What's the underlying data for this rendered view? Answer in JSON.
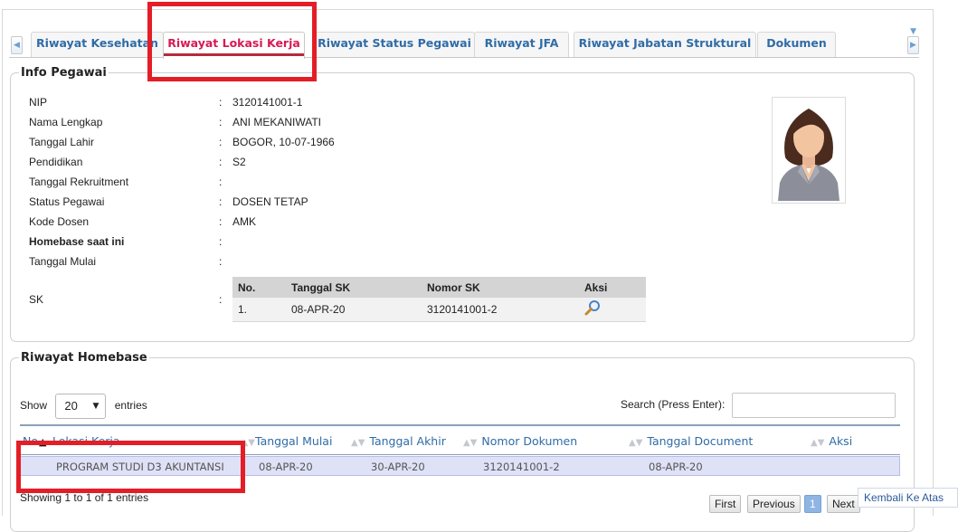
{
  "tabs": [
    {
      "label": "Riwayat Kesehatan",
      "active": false
    },
    {
      "label": "Riwayat Lokasi Kerja",
      "active": true
    },
    {
      "label": "Riwayat Status Pegawai",
      "active": false
    },
    {
      "label": "Riwayat JFA",
      "active": false
    },
    {
      "label": "Riwayat Jabatan Struktural",
      "active": false
    },
    {
      "label": "Dokumen",
      "active": false
    }
  ],
  "info": {
    "legend": "Info Pegawai",
    "fields": [
      {
        "label": "NIP",
        "value": "3120141001-1"
      },
      {
        "label": "Nama Lengkap",
        "value": "ANI MEKANIWATI"
      },
      {
        "label": "Tanggal Lahir",
        "value": "BOGOR, 10-07-1966"
      },
      {
        "label": "Pendidikan",
        "value": "S2"
      },
      {
        "label": "Tanggal Rekruitment",
        "value": ""
      },
      {
        "label": "Status Pegawai",
        "value": "DOSEN TETAP"
      },
      {
        "label": "Kode Dosen",
        "value": "AMK"
      },
      {
        "label": "Homebase saat ini",
        "value": ""
      },
      {
        "label": "Tanggal Mulai",
        "value": ""
      }
    ],
    "sk_label": "SK",
    "colon": ":",
    "sk_table": {
      "headers": [
        "No.",
        "Tanggal SK",
        "Nomor SK",
        "Aksi"
      ],
      "rows": [
        {
          "no": "1.",
          "tanggal": "08-APR-20",
          "nomor": "3120141001-2",
          "aksi_icon": "magnifier-icon"
        }
      ]
    }
  },
  "homebase": {
    "legend": "Riwayat Homebase",
    "show_label": "Show",
    "entries_value": "20",
    "entries_label": "entries",
    "search_label": "Search (Press Enter):",
    "search_value": "",
    "columns": [
      "No",
      "Lokasi Kerja",
      "Tanggal Mulai",
      "Tanggal Akhir",
      "Nomor Dokumen",
      "Tanggal Document",
      "Aksi"
    ],
    "rows": [
      {
        "lokasi": "PROGRAM STUDI D3 AKUNTANSI",
        "mulai": "08-APR-20",
        "akhir": "30-APR-20",
        "nomor": "3120141001-2",
        "tanggal_doc": "08-APR-20"
      }
    ],
    "showing": "Showing 1 to 1 of 1 entries",
    "pager": {
      "first": "First",
      "previous": "Previous",
      "page": "1",
      "next": "Next"
    }
  },
  "back_to_top": "Kembali Ke Atas",
  "colors": {
    "active_tab": "#d61a55",
    "link": "#2f6ca7",
    "highlight": "#e41e26"
  }
}
